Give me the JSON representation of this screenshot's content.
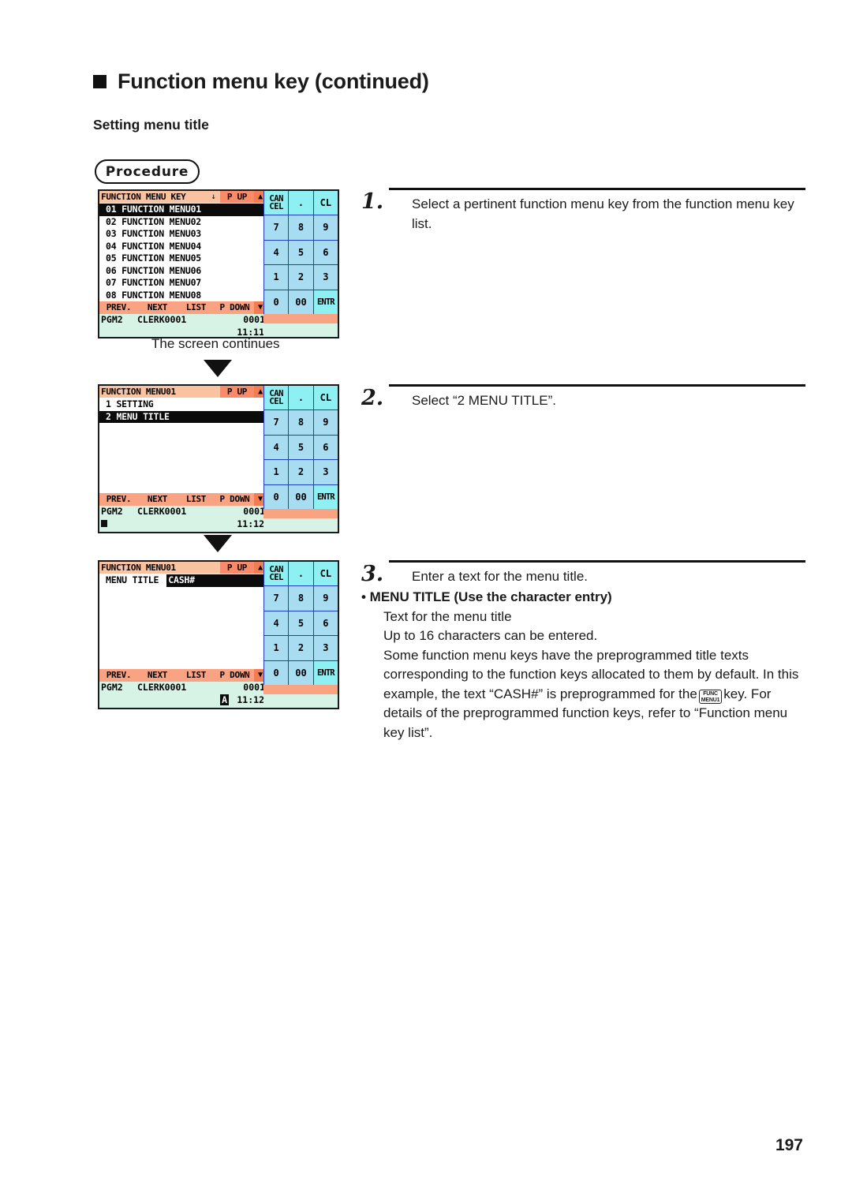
{
  "page": {
    "heading": "Function menu key (continued)",
    "subheading": "Setting menu title",
    "procedure_label": "Procedure",
    "page_number": "197",
    "continues_note": "The screen continues",
    "accent_colors": {
      "titlebar": "#f9c2a0",
      "titlebar_accent": "#f98b6a",
      "softkey_bar": "#f9a383",
      "status_bar": "#d7f3e6",
      "keypad_key": "#a8dcf0",
      "keypad_key_cyan": "#8ef0f2",
      "selection": "#0b0b0b"
    }
  },
  "keypad": {
    "rows": [
      [
        {
          "label": "CAN\nCEL",
          "style": "cyan"
        },
        {
          "label": ".",
          "style": "cyan"
        },
        {
          "label": "CL",
          "style": "cyan"
        }
      ],
      [
        {
          "label": "7",
          "style": "blue"
        },
        {
          "label": "8",
          "style": "blue"
        },
        {
          "label": "9",
          "style": "blue"
        }
      ],
      [
        {
          "label": "4",
          "style": "blue"
        },
        {
          "label": "5",
          "style": "blue"
        },
        {
          "label": "6",
          "style": "blue"
        }
      ],
      [
        {
          "label": "1",
          "style": "blue"
        },
        {
          "label": "2",
          "style": "blue"
        },
        {
          "label": "3",
          "style": "blue"
        }
      ],
      [
        {
          "label": "0",
          "style": "blue"
        },
        {
          "label": "00",
          "style": "blue"
        },
        {
          "label": "ENTR",
          "style": "cyan"
        }
      ]
    ],
    "cancel_line1": "CAN",
    "cancel_line2": "CEL"
  },
  "softkeys": {
    "prev": "PREV.",
    "next": "NEXT",
    "list": "LIST",
    "pdown": "P DOWN",
    "arrow_down": "▼",
    "arrow_up": "▲",
    "title_arrow_down": "↓",
    "p_up": "P UP"
  },
  "screens": [
    {
      "id": "function-menu-key-list",
      "title": "FUNCTION MENU KEY",
      "rows": [
        {
          "text": "01 FUNCTION MENU01",
          "selected": true
        },
        {
          "text": "02 FUNCTION MENU02",
          "selected": false
        },
        {
          "text": "03 FUNCTION MENU03",
          "selected": false
        },
        {
          "text": "04 FUNCTION MENU04",
          "selected": false
        },
        {
          "text": "05 FUNCTION MENU05",
          "selected": false
        },
        {
          "text": "06 FUNCTION MENU06",
          "selected": false
        },
        {
          "text": "07 FUNCTION MENU07",
          "selected": false
        },
        {
          "text": "08 FUNCTION MENU08",
          "selected": false
        }
      ],
      "status": {
        "mode": "PGM2",
        "clerk": "CLERK0001",
        "count": "0001",
        "time": "11:11",
        "flag": "",
        "cursor": false
      }
    },
    {
      "id": "function-menu01-options",
      "title": "FUNCTION MENU01",
      "rows": [
        {
          "text": "1 SETTING",
          "selected": false
        },
        {
          "text": "2 MENU TITLE",
          "selected": true
        }
      ],
      "status": {
        "mode": "PGM2",
        "clerk": "CLERK0001",
        "count": "0001",
        "time": "11:12",
        "flag": "",
        "cursor": true
      }
    },
    {
      "id": "menu-title-entry",
      "title": "FUNCTION MENU01",
      "field_label": "MENU TITLE",
      "field_value": "CASH#",
      "status": {
        "mode": "PGM2",
        "clerk": "CLERK0001",
        "count": "0001",
        "time": "11:12",
        "flag": "A",
        "cursor": false
      }
    }
  ],
  "steps": [
    {
      "number": "1.",
      "text": "Select a pertinent function menu key from the function menu key list."
    },
    {
      "number": "2.",
      "text": "Select “2 MENU TITLE”."
    },
    {
      "number": "3.",
      "text": "Enter a text for the menu title."
    }
  ],
  "menu_title_note": {
    "heading": "• MENU TITLE (Use the character entry)",
    "line1": "Text for the menu title",
    "line2": "Up to 16 characters can be entered.",
    "line3_a": "Some function menu keys have the preprogrammed title texts corresponding to the function keys allocated to them by default. In this example, the text “CASH#” is preprogrammed for the",
    "key_glyph_line1": "FUNC",
    "key_glyph_line2": "MENU1",
    "line3_b": "key. For details of the preprogrammed function keys, refer to “Function menu key list”."
  }
}
